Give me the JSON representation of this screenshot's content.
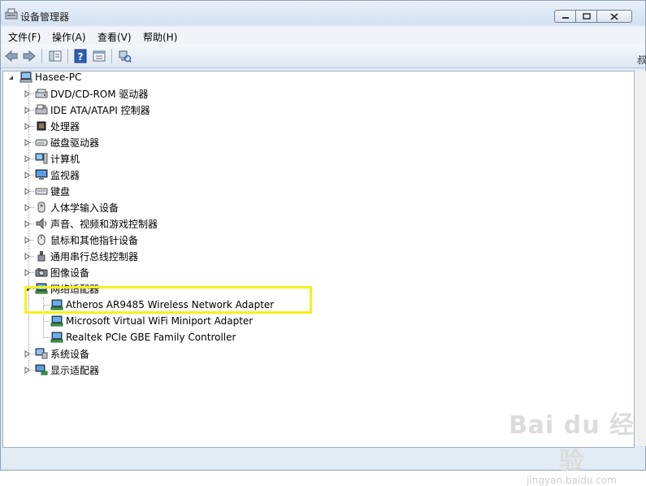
{
  "window": {
    "title": "设备管理器",
    "caption": {
      "minimize": "minimize",
      "maximize": "maximize",
      "close": "close"
    }
  },
  "menubar": {
    "items": [
      "文件(F)",
      "操作(A)",
      "查看(V)",
      "帮助(H)"
    ]
  },
  "sidepane_partial_text": "叔",
  "tree": {
    "root": "Hasee-PC",
    "categories": [
      {
        "label": "DVD/CD-ROM 驱动器",
        "icon": "dvd-drive-icon"
      },
      {
        "label": "IDE ATA/ATAPI 控制器",
        "icon": "ide-controller-icon"
      },
      {
        "label": "处理器",
        "icon": "processor-icon"
      },
      {
        "label": "磁盘驱动器",
        "icon": "disk-drive-icon"
      },
      {
        "label": "计算机",
        "icon": "computer-icon"
      },
      {
        "label": "监视器",
        "icon": "monitor-icon"
      },
      {
        "label": "键盘",
        "icon": "keyboard-icon"
      },
      {
        "label": "人体学输入设备",
        "icon": "hid-icon"
      },
      {
        "label": "声音、视频和游戏控制器",
        "icon": "sound-icon"
      },
      {
        "label": "鼠标和其他指针设备",
        "icon": "mouse-icon"
      },
      {
        "label": "通用串行总线控制器",
        "icon": "usb-icon"
      },
      {
        "label": "图像设备",
        "icon": "camera-icon"
      },
      {
        "label": "网络适配器",
        "icon": "network-adapter-icon"
      }
    ],
    "network_children": [
      "Atheros AR9485 Wireless Network Adapter",
      "Microsoft Virtual WiFi Miniport Adapter",
      "Realtek PCIe GBE Family Controller"
    ],
    "categories_after": [
      {
        "label": "系统设备",
        "icon": "system-device-icon"
      },
      {
        "label": "显示适配器",
        "icon": "display-adapter-icon"
      }
    ]
  },
  "watermark": {
    "main": "Bai du 经验",
    "sub": "jingyan.baidu.com"
  },
  "colors": {
    "highlight": "#f3f31d",
    "titlebar": "#dfe9f5"
  }
}
